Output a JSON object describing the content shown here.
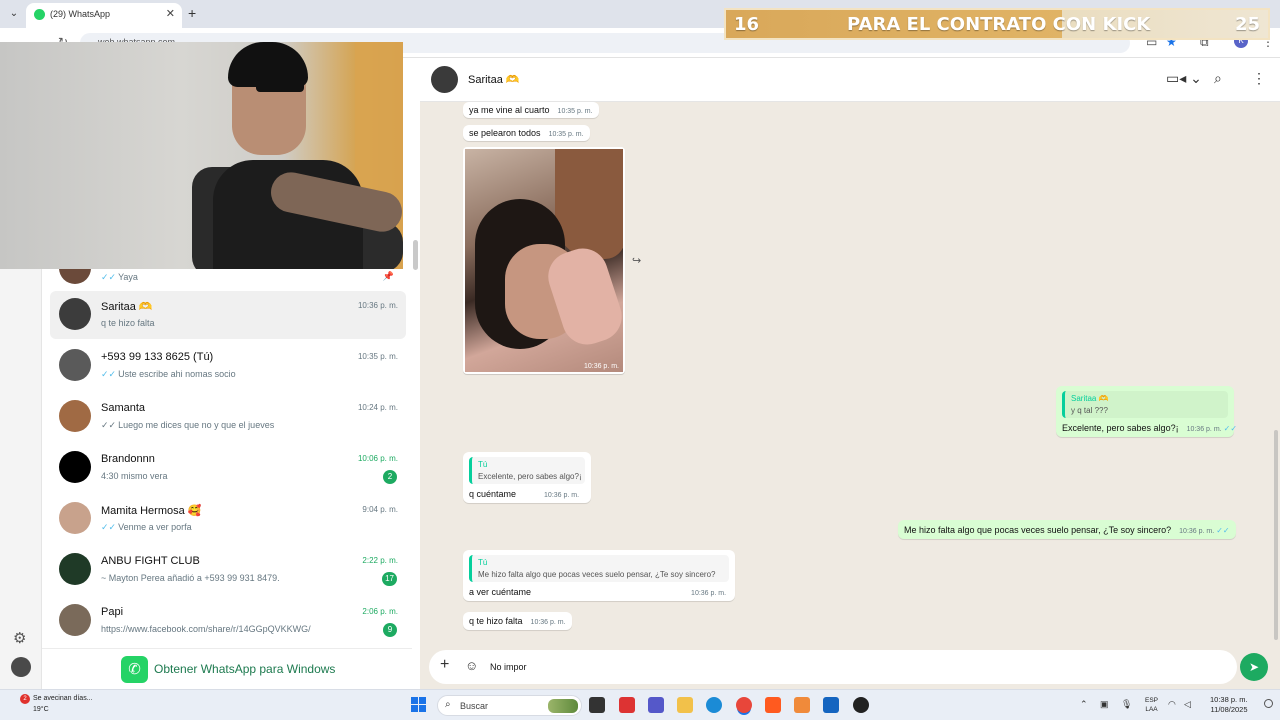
{
  "browser": {
    "tab_title": "(29) WhatsApp",
    "tab_close": "✕",
    "new_tab": "+",
    "url": "web.whatsapp.com",
    "profile_initial": "K"
  },
  "banner": {
    "left_number": "16",
    "text": "PARA EL CONTRATO CON KICK",
    "right_number": "25"
  },
  "chat_list": [
    {
      "name": "",
      "preview": "Yaya",
      "time": "",
      "ticks": true,
      "pinned": true,
      "avatar_color": "#6b4a3a"
    },
    {
      "name": "Saritaa 🫶",
      "preview": "q te hizo falta",
      "time": "10:36 p. m.",
      "ticks": false,
      "active": true,
      "avatar_color": "#3c3c3c"
    },
    {
      "name": "+593 99 133 8625 (Tú)",
      "preview": "Uste escribe ahi nomas socio",
      "time": "10:35 p. m.",
      "ticks": true,
      "avatar_color": "#5a5a5a"
    },
    {
      "name": "Samanta",
      "preview": "Luego me dices que no y que el jueves",
      "time": "10:24 p. m.",
      "ticks": true,
      "avatar_color": "#a06a44"
    },
    {
      "name": "Brandonnn",
      "preview": "4:30 mismo vera",
      "time": "10:06 p. m.",
      "badge": "2",
      "unread": true,
      "avatar_color": "#000000"
    },
    {
      "name": "Mamita Hermosa 🥰",
      "preview": "Venme a ver porfa",
      "time": "9:04 p. m.",
      "ticks": true,
      "avatar_color": "#c8a28c"
    },
    {
      "name": "ANBU FIGHT CLUB",
      "preview": "~ Mayton  Perea añadió a +593 99 931 8479.",
      "time": "2:22 p. m.",
      "badge": "17",
      "unread": true,
      "avatar_color": "#1f3a27"
    },
    {
      "name": "Papi",
      "preview": "https://www.facebook.com/share/r/14GGpQVKKWG/",
      "time": "2:06 p. m.",
      "badge": "9",
      "unread": true,
      "avatar_color": "#7a6a5a"
    }
  ],
  "get_whatsapp": "Obtener WhatsApp para Windows",
  "chat": {
    "title": "Saritaa 🫶",
    "messages": [
      {
        "text": "ya me vine al cuarto",
        "time": "10:35 p. m."
      },
      {
        "text": "se pelearon todos",
        "time": "10:35 p. m."
      }
    ],
    "image_time": "10:36 p. m.",
    "out_reply_1": {
      "quote_author": "Saritaa 🫶",
      "quote_text": "y q tal ???",
      "text": "Excelente, pero sabes algo?¡",
      "time": "10:36 p. m."
    },
    "in_reply_1": {
      "quote_author": "Tú",
      "quote_text": "Excelente, pero sabes algo?¡",
      "text": "q cuéntame",
      "time": "10:36 p. m."
    },
    "out_msg_2": {
      "text": "Me hizo falta algo que pocas veces suelo pensar, ¿Te soy sincero?",
      "time": "10:36 p. m."
    },
    "in_reply_2": {
      "quote_author": "Tú",
      "quote_text": "Me hizo falta algo que pocas veces suelo pensar, ¿Te soy sincero?",
      "text": "a ver cuéntame",
      "time": "10:36 p. m."
    },
    "last_in": {
      "text": "q te hizo falta",
      "time": "10:36 p. m."
    },
    "composer_text": "No impor"
  },
  "taskbar": {
    "weather_text": "Se avecinan días...",
    "weather_temp": "19°C",
    "weather_badge": "2",
    "search_label": "Buscar",
    "lang_top": "ESP",
    "lang_bottom": "LAA",
    "time": "10:38 p. m.",
    "date": "11/08/2025"
  }
}
